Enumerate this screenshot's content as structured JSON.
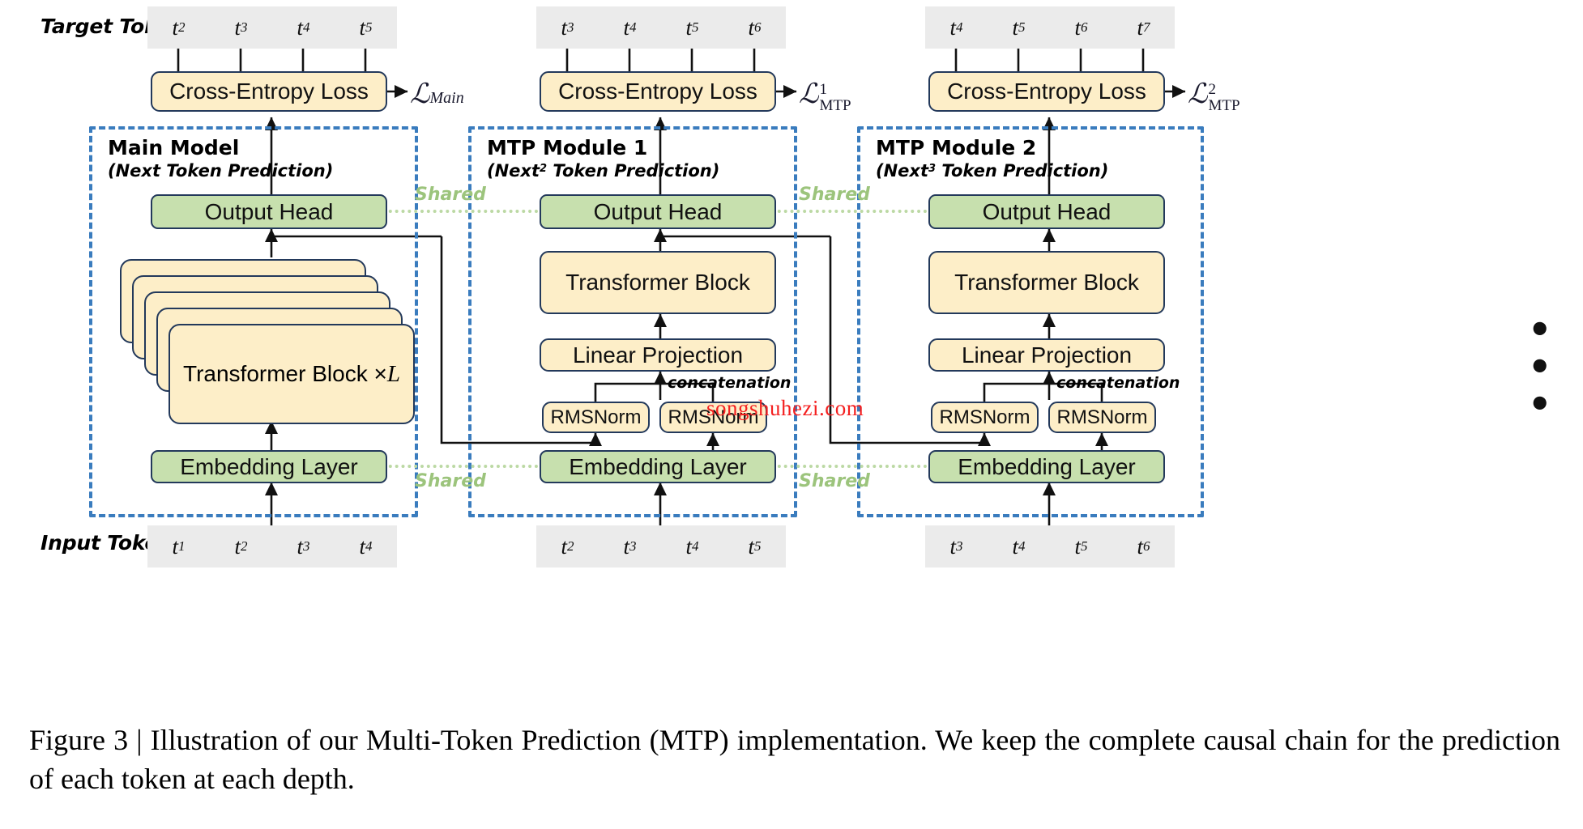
{
  "figure": {
    "caption": "Figure 3 | Illustration of our Multi-Token Prediction (MTP) implementation.  We keep the complete causal chain for the prediction of each token at each depth.",
    "watermark": "songshuhezi.com",
    "ellipsis": "• • •"
  },
  "row_labels": {
    "target": "Target Tokens",
    "input": "Input Tokens"
  },
  "colors": {
    "yellow_fill": "#fdeec8",
    "green_fill": "#c7e0ae",
    "box_stroke": "#23395b",
    "module_dash": "#3a7cbe",
    "token_chip": "#ebebeb",
    "shared_dotted": "#bcd9a4",
    "shared_text": "#9cc47c",
    "watermark": "#f42020"
  },
  "shared_labels": {
    "head_1": "Shared",
    "head_2": "Shared",
    "embed_1": "Shared",
    "embed_2": "Shared"
  },
  "annotations": {
    "concat_1": "concatenation",
    "concat_2": "concatenation"
  },
  "columns": [
    {
      "id": "main",
      "title": "Main Model",
      "subtitle_pre": "(Next",
      "subtitle_sup": "",
      "subtitle_post": " Token Prediction)",
      "loss": {
        "symbol": "ℒ",
        "sup": "",
        "sub": "Main"
      },
      "loss_box": "Cross-Entropy Loss",
      "output_head": "Output Head",
      "embedding": "Embedding Layer",
      "transformer": "Transformer Block × ",
      "transformer_mult": "L",
      "target_tokens": [
        {
          "base": "t",
          "idx": "2"
        },
        {
          "base": "t",
          "idx": "3"
        },
        {
          "base": "t",
          "idx": "4"
        },
        {
          "base": "t",
          "idx": "5"
        }
      ],
      "input_tokens": [
        {
          "base": "t",
          "idx": "1"
        },
        {
          "base": "t",
          "idx": "2"
        },
        {
          "base": "t",
          "idx": "3"
        },
        {
          "base": "t",
          "idx": "4"
        }
      ]
    },
    {
      "id": "mtp1",
      "title": "MTP Module 1",
      "subtitle_pre": "(Next",
      "subtitle_sup": "2",
      "subtitle_post": " Token Prediction)",
      "loss": {
        "symbol": "ℒ",
        "sup": "1",
        "sub": "MTP"
      },
      "loss_box": "Cross-Entropy Loss",
      "output_head": "Output Head",
      "embedding": "Embedding Layer",
      "transformer": "Transformer Block",
      "linear_projection": "Linear Projection",
      "rmsnorm_left": "RMSNorm",
      "rmsnorm_right": "RMSNorm",
      "target_tokens": [
        {
          "base": "t",
          "idx": "3"
        },
        {
          "base": "t",
          "idx": "4"
        },
        {
          "base": "t",
          "idx": "5"
        },
        {
          "base": "t",
          "idx": "6"
        }
      ],
      "input_tokens": [
        {
          "base": "t",
          "idx": "2"
        },
        {
          "base": "t",
          "idx": "3"
        },
        {
          "base": "t",
          "idx": "4"
        },
        {
          "base": "t",
          "idx": "5"
        }
      ]
    },
    {
      "id": "mtp2",
      "title": "MTP Module 2",
      "subtitle_pre": "(Next",
      "subtitle_sup": "3",
      "subtitle_post": " Token Prediction)",
      "loss": {
        "symbol": "ℒ",
        "sup": "2",
        "sub": "MTP"
      },
      "loss_box": "Cross-Entropy Loss",
      "output_head": "Output Head",
      "embedding": "Embedding Layer",
      "transformer": "Transformer Block",
      "linear_projection": "Linear Projection",
      "rmsnorm_left": "RMSNorm",
      "rmsnorm_right": "RMSNorm",
      "target_tokens": [
        {
          "base": "t",
          "idx": "4"
        },
        {
          "base": "t",
          "idx": "5"
        },
        {
          "base": "t",
          "idx": "6"
        },
        {
          "base": "t",
          "idx": "7"
        }
      ],
      "input_tokens": [
        {
          "base": "t",
          "idx": "3"
        },
        {
          "base": "t",
          "idx": "4"
        },
        {
          "base": "t",
          "idx": "5"
        },
        {
          "base": "t",
          "idx": "6"
        }
      ]
    }
  ]
}
